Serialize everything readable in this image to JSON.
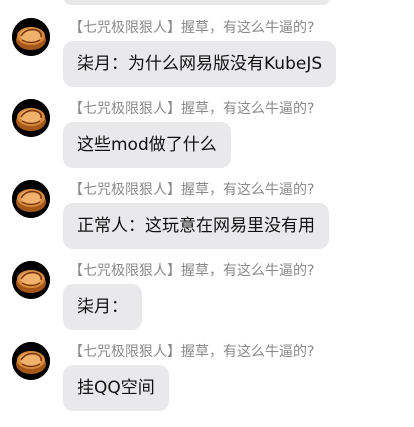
{
  "messages": [
    {
      "sender": "【七咒极限狠人】握草，有这么牛逼的?",
      "text": "柒月：为什么网易版没有KubeJS"
    },
    {
      "sender": "【七咒极限狠人】握草，有这么牛逼的?",
      "text": "这些mod做了什么"
    },
    {
      "sender": "【七咒极限狠人】握草，有这么牛逼的?",
      "text": "正常人：这玩意在网易里没有用"
    },
    {
      "sender": "【七咒极限狠人】握草，有这么牛逼的?",
      "text": "柒月："
    },
    {
      "sender": "【七咒极限狠人】握草，有这么牛逼的?",
      "text": "挂QQ空间"
    }
  ],
  "colors": {
    "bubble_background": "#e9e9eb",
    "sender_text": "#8a8a8a",
    "message_text": "#111111",
    "page_background": "#ffffff"
  },
  "icons": {
    "avatar": "pie-avatar-icon"
  }
}
